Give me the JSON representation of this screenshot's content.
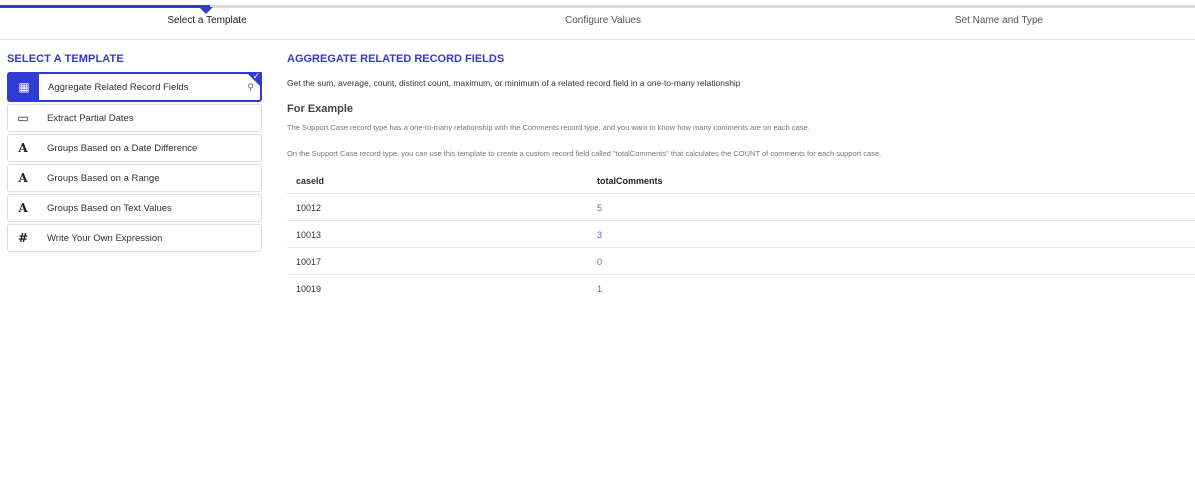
{
  "wizard": {
    "steps": [
      "Select a Template",
      "Configure Values",
      "Set Name and Type"
    ]
  },
  "left": {
    "heading": "SELECT A TEMPLATE",
    "templates": [
      {
        "label": "Aggregate Related Record Fields",
        "icon": "calculator-icon",
        "glyph": "▦"
      },
      {
        "label": "Extract Partial Dates",
        "icon": "calendar-icon",
        "glyph": "▭"
      },
      {
        "label": "Groups Based on a Date Difference",
        "icon": "text-a-icon",
        "glyph": "A"
      },
      {
        "label": "Groups Based on a Range",
        "icon": "text-a-icon",
        "glyph": "A"
      },
      {
        "label": "Groups Based on Text Values",
        "icon": "text-a-icon",
        "glyph": "A"
      },
      {
        "label": "Write Your Own Expression",
        "icon": "hash-icon",
        "glyph": "#"
      }
    ],
    "selected_check": "✓",
    "selected_extra_icon": "⚲"
  },
  "right": {
    "heading": "AGGREGATE RELATED RECORD FIELDS",
    "description": "Get the sum, average, count, distinct count, maximum, or minimum of a related record field in a one-to-many relationship",
    "example_title": "For Example",
    "example_line1": "The Support Case record type has a one-to-many relationship with the Comments record type, and you want to know how many comments are on each case.",
    "example_line2": "On the Support Case record type, you can use this template to create a custom record field called \"totalComments\" that calculates the COUNT of comments for each support case.",
    "table": {
      "columns": [
        "caseId",
        "totalComments"
      ],
      "rows": [
        [
          "10012",
          "5"
        ],
        [
          "10013",
          "3"
        ],
        [
          "10017",
          "0"
        ],
        [
          "10019",
          "1"
        ]
      ]
    }
  },
  "colors": {
    "accent": "#2f3bd1",
    "number": "#7a4fd1"
  }
}
